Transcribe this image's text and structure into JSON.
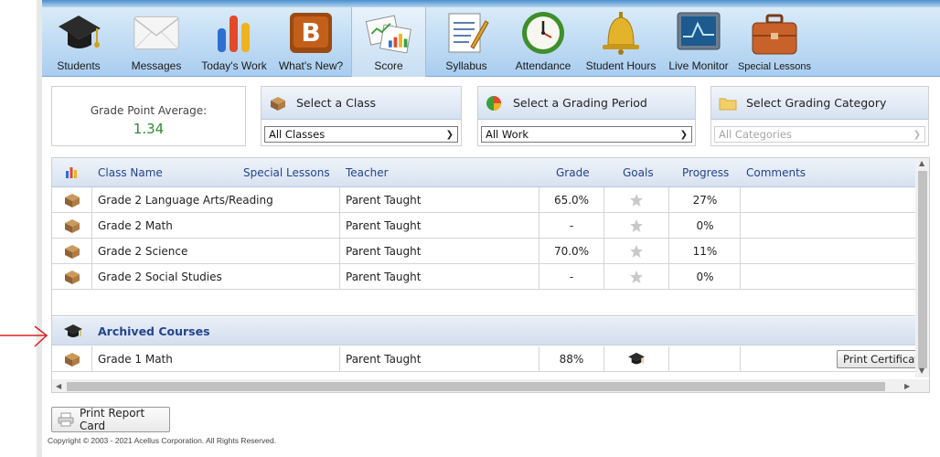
{
  "toolbar": {
    "items": [
      {
        "label": "Students",
        "icon": "graduation-cap-icon"
      },
      {
        "label": "Messages",
        "icon": "envelope-icon"
      },
      {
        "label": "Today's Work",
        "icon": "bar-chart-icon"
      },
      {
        "label": "What's New?",
        "icon": "blogger-icon"
      },
      {
        "label": "Score",
        "icon": "score-chart-icon"
      },
      {
        "label": "Syllabus",
        "icon": "syllabus-icon"
      },
      {
        "label": "Attendance",
        "icon": "clock-icon"
      },
      {
        "label": "Student Hours",
        "icon": "bell-icon"
      },
      {
        "label": "Live Monitor",
        "icon": "monitor-icon"
      },
      {
        "label": "Special Lessons",
        "icon": "briefcase-icon"
      }
    ],
    "active": "Score"
  },
  "gpa": {
    "label": "Grade Point Average:",
    "value": "1.34"
  },
  "class_select": {
    "header": "Select a Class",
    "value": "All Classes"
  },
  "period_select": {
    "header": "Select a Grading Period",
    "value": "All Work"
  },
  "category_select": {
    "header": "Select Grading Category",
    "value": "All Categories"
  },
  "table": {
    "headers": {
      "class_name": "Class Name",
      "special_lessons": "Special Lessons",
      "teacher": "Teacher",
      "grade": "Grade",
      "goals": "Goals",
      "progress": "Progress",
      "comments": "Comments"
    },
    "rows": [
      {
        "class_name": "Grade 2 Language Arts/Reading",
        "teacher": "Parent Taught",
        "grade": "65.0%",
        "progress": "27%"
      },
      {
        "class_name": "Grade 2 Math",
        "teacher": "Parent Taught",
        "grade": "-",
        "progress": "0%"
      },
      {
        "class_name": "Grade 2 Science",
        "teacher": "Parent Taught",
        "grade": "70.0%",
        "progress": "11%"
      },
      {
        "class_name": "Grade 2 Social Studies",
        "teacher": "Parent Taught",
        "grade": "-",
        "progress": "0%"
      }
    ],
    "archived_label": "Archived Courses",
    "archived_rows": [
      {
        "class_name": "Grade 1 Math",
        "teacher": "Parent Taught",
        "grade": "88%",
        "button": "Print Certificate"
      }
    ]
  },
  "print_report_card": "Print Report Card",
  "copyright": "Copyright © 2003 - 2021 Acellus Corporation.  All Rights Reserved."
}
